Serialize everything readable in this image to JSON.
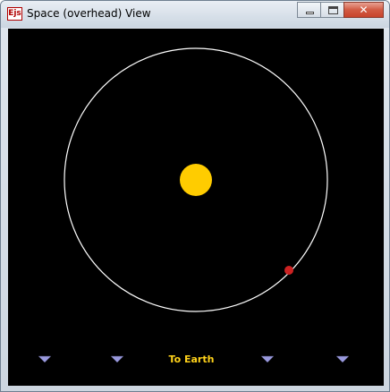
{
  "window": {
    "title": "Space (overhead) View",
    "icon_text": "Ejs",
    "icon": "ejs-app-icon",
    "close_glyph": "✕"
  },
  "scene": {
    "background": "#000000",
    "sun_color": "#ffcc00",
    "orbit_color": "#ffffff",
    "earth_color": "#cc2222",
    "arrow_color": "#9999dd"
  },
  "controls": {
    "to_earth_label": "To Earth",
    "arrow_icon": "triangle-down-icon"
  }
}
